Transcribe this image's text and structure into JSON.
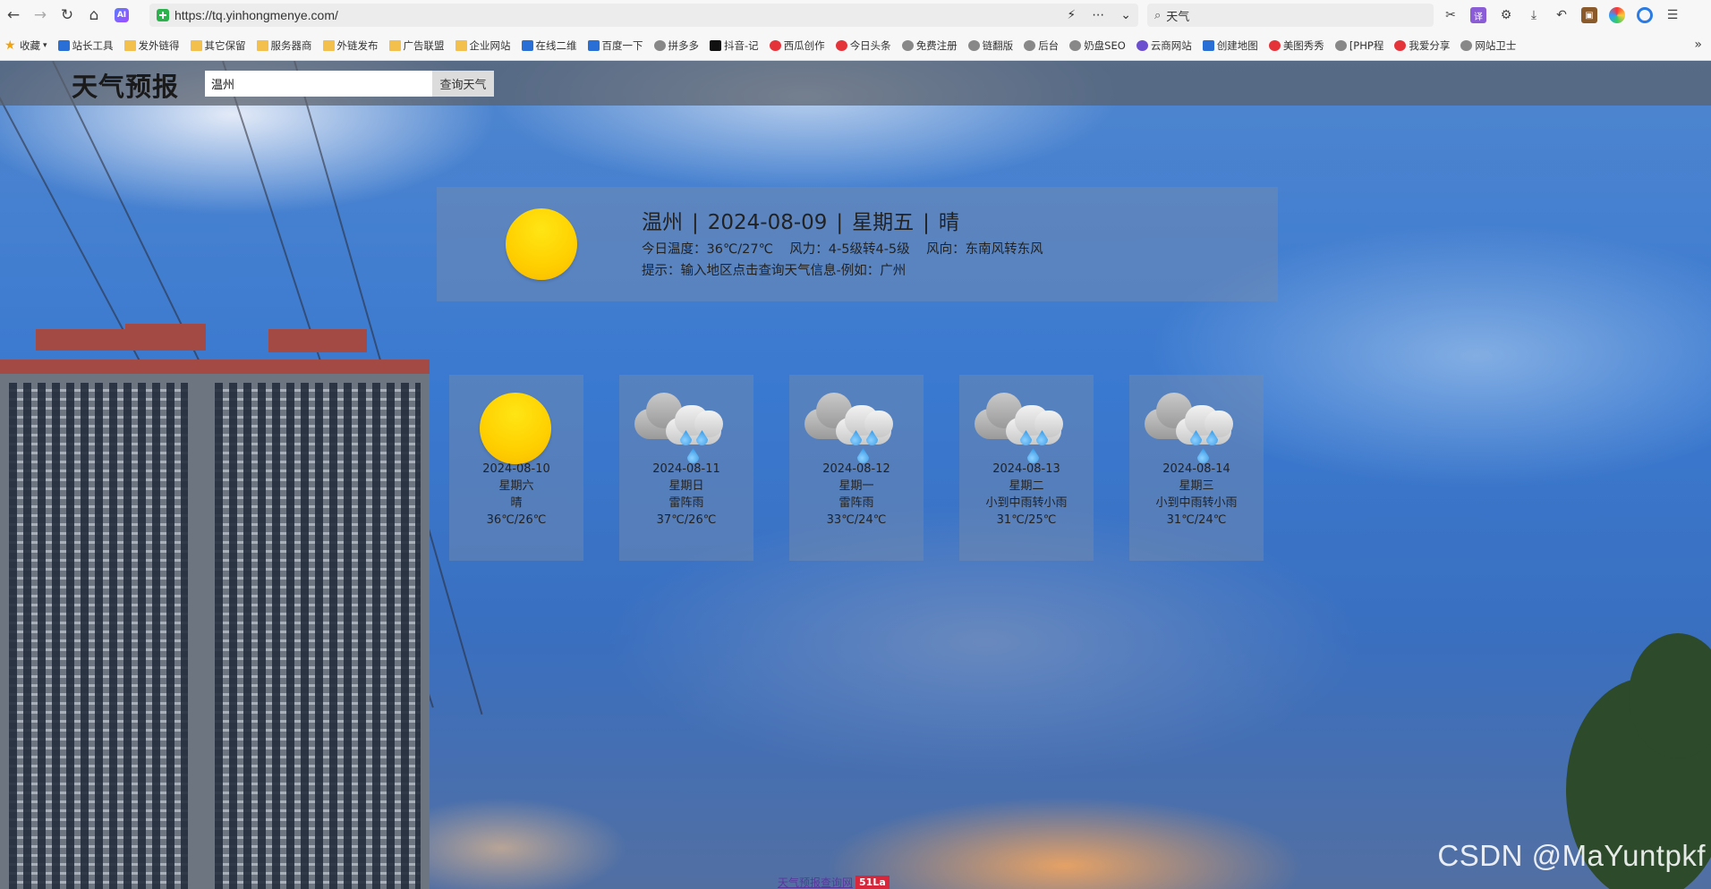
{
  "browser": {
    "url": "https://tq.yinhongmenye.com/",
    "search_text": "天气",
    "ai_badge": "AI",
    "nav_icons": [
      "back-icon",
      "forward-icon",
      "reload-icon",
      "home-icon"
    ],
    "bookmarks": [
      {
        "label": "收藏",
        "icon": "star"
      },
      {
        "label": "站长工具",
        "icon": "blue"
      },
      {
        "label": "发外链得",
        "icon": "folder"
      },
      {
        "label": "其它保留",
        "icon": "folder"
      },
      {
        "label": "服务器商",
        "icon": "folder"
      },
      {
        "label": "外链发布",
        "icon": "folder"
      },
      {
        "label": "广告联盟",
        "icon": "folder"
      },
      {
        "label": "企业网站",
        "icon": "folder"
      },
      {
        "label": "在线二维",
        "icon": "blue"
      },
      {
        "label": "百度一下",
        "icon": "blue"
      },
      {
        "label": "拼多多",
        "icon": "gray"
      },
      {
        "label": "抖音-记",
        "icon": "black"
      },
      {
        "label": "西瓜创作",
        "icon": "red"
      },
      {
        "label": "今日头条",
        "icon": "red"
      },
      {
        "label": "免费注册",
        "icon": "gray"
      },
      {
        "label": "链翻版",
        "icon": "gray"
      },
      {
        "label": "后台",
        "icon": "gray"
      },
      {
        "label": "奶盘SEO",
        "icon": "gray"
      },
      {
        "label": "云商网站",
        "icon": "purple"
      },
      {
        "label": "创建地图",
        "icon": "blue"
      },
      {
        "label": "美图秀秀",
        "icon": "red"
      },
      {
        "label": "[PHP程",
        "icon": "gray"
      },
      {
        "label": "我爱分享",
        "icon": "red"
      },
      {
        "label": "网站卫士",
        "icon": "gray"
      }
    ],
    "more": "»"
  },
  "site": {
    "title": "天气预报",
    "input_value": "温州",
    "query_label": "查询天气"
  },
  "today": {
    "city": "温州",
    "date": "2024-08-09",
    "weekday": "星期五",
    "weather": "晴",
    "separator": "|",
    "temp_label": "今日温度：",
    "temp": "36℃/27℃",
    "wind_label": "风力：",
    "wind": "4-5级转4-5级",
    "wind_dir_label": "风向：",
    "wind_dir": "东南风转东风",
    "tip": "提示：输入地区点击查询天气信息-例如：广州",
    "icon": "sun-icon"
  },
  "forecast": [
    {
      "date": "2024-08-10",
      "weekday": "星期六",
      "weather": "晴",
      "temp": "36℃/26℃",
      "icon": "sun-icon"
    },
    {
      "date": "2024-08-11",
      "weekday": "星期日",
      "weather": "雷阵雨",
      "temp": "37℃/26℃",
      "icon": "rain-cloud-icon"
    },
    {
      "date": "2024-08-12",
      "weekday": "星期一",
      "weather": "雷阵雨",
      "temp": "33℃/24℃",
      "icon": "rain-cloud-icon"
    },
    {
      "date": "2024-08-13",
      "weekday": "星期二",
      "weather": "小到中雨转小雨",
      "temp": "31℃/25℃",
      "icon": "rain-cloud-icon"
    },
    {
      "date": "2024-08-14",
      "weekday": "星期三",
      "weather": "小到中雨转小雨",
      "temp": "31℃/24℃",
      "icon": "rain-cloud-icon"
    }
  ],
  "footer": {
    "link": "天气预报查询网",
    "badge": "51La"
  },
  "watermark": "CSDN @MaYuntpkf"
}
